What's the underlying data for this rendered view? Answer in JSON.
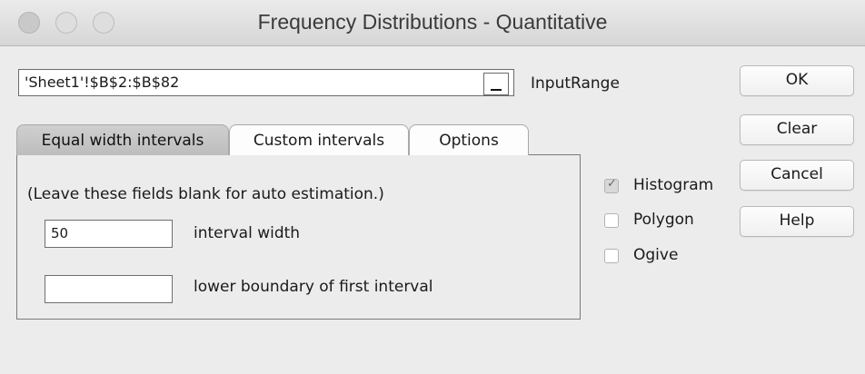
{
  "window": {
    "title": "Frequency Distributions - Quantitative"
  },
  "input_range": {
    "value": "'Sheet1'!$B$2:$B$82",
    "label": "InputRange"
  },
  "buttons": {
    "ok": "OK",
    "clear": "Clear",
    "cancel": "Cancel",
    "help": "Help"
  },
  "tabs": [
    {
      "label": "Equal width intervals",
      "active": true
    },
    {
      "label": "Custom intervals",
      "active": false
    },
    {
      "label": "Options",
      "active": false
    }
  ],
  "panel": {
    "hint": "(Leave these fields  blank for auto estimation.)",
    "interval_width": {
      "value": "50",
      "label": "interval width"
    },
    "lower_boundary": {
      "value": "",
      "label": "lower boundary of first interval"
    }
  },
  "checkboxes": [
    {
      "label": "Histogram",
      "checked": true
    },
    {
      "label": "Polygon",
      "checked": false
    },
    {
      "label": "Ogive",
      "checked": false
    }
  ]
}
